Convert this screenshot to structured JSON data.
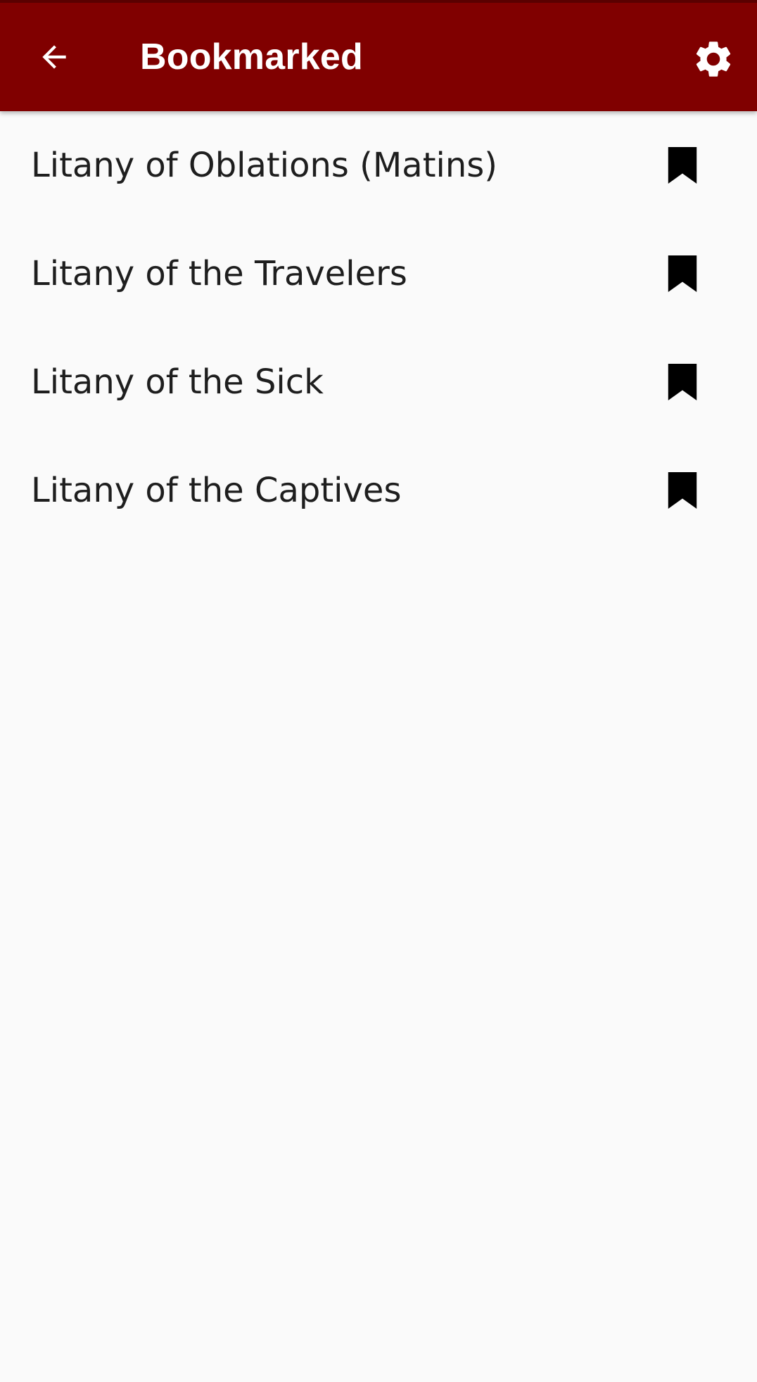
{
  "app_bar": {
    "title": "Bookmarked",
    "background_color": "#800000",
    "back_icon": "arrow-back-icon",
    "settings_icon": "gear-icon"
  },
  "bookmarks": [
    {
      "label": "Litany of Oblations (Matins)",
      "icon": "bookmark-icon"
    },
    {
      "label": "Litany of the Travelers",
      "icon": "bookmark-icon"
    },
    {
      "label": "Litany of the Sick",
      "icon": "bookmark-icon"
    },
    {
      "label": "Litany of the Captives",
      "icon": "bookmark-icon"
    }
  ]
}
